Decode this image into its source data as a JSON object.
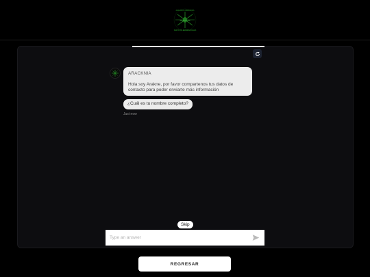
{
  "header": {
    "logo_top_text": "ARACKNIA • ASESORÍAS",
    "logo_center_text": "ARACKNIA",
    "logo_bottom_text": "SERVICIOS EMPRESARIALES"
  },
  "chat": {
    "progress_fraction": 1.0,
    "bot_name": "ARACKNIA",
    "greeting": "Hola soy Arakne, por favor compartenos tus datos de contacto para poder enviarte más información",
    "question": "¿Cuál es tu nombre completo?",
    "timestamp": "Just now",
    "skip_label": "Skip",
    "answer_placeholder": "Type an answer",
    "answer_value": ""
  },
  "footer": {
    "back_label": "REGRESAR"
  },
  "colors": {
    "background": "#000000",
    "panel": "#0d0d10",
    "bubble": "#ececec",
    "logo_green": "#2aa02a"
  },
  "icons": {
    "refresh": "refresh-icon",
    "send": "send-icon",
    "avatar": "spider-logo-icon"
  }
}
